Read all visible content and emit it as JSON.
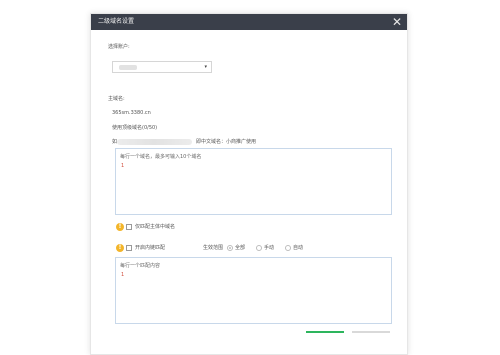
{
  "dialog": {
    "title": "二级域名设置",
    "close_glyph": "✕"
  },
  "account": {
    "label": "选择账户:",
    "selected_value": "",
    "chevron": "▾"
  },
  "domain": {
    "label": "主域名:",
    "value": "365sm.3380.cn",
    "usage": "使用顶级域名(0/50)",
    "prefix": "如:",
    "suffix": "即中文域名：小商推广使用"
  },
  "domain_input": {
    "hint": "每行一个域名，最多可输入10个域名",
    "line_number": "1"
  },
  "option_only_hosted": {
    "label": "仅匹配主体中域名"
  },
  "option_enable_rules": {
    "label": "开启内链匹配",
    "scope_label": "生效范围",
    "choices": [
      "全部",
      "手动",
      "自动"
    ],
    "selected": "全部"
  },
  "rules_input": {
    "hint": "每行一个匹配内容",
    "line_number": "1"
  },
  "colors": {
    "titlebar": "#3a3f4a",
    "confirm_accent": "#2db55d",
    "cancel": "#d9d9d9",
    "warning": "#f3b52a"
  }
}
